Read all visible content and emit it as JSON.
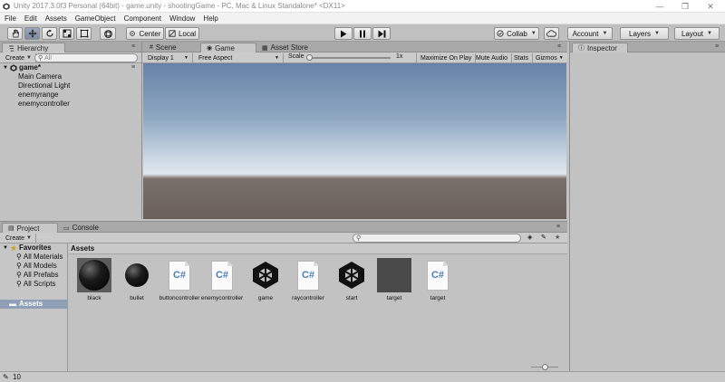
{
  "window": {
    "title": "Unity 2017.3.0f3 Personal (64bit) - game.unity - shootingGame - PC, Mac & Linux Standalone* <DX11>",
    "minimize": "—",
    "maximize": "❐",
    "close": "✕"
  },
  "menu": [
    "File",
    "Edit",
    "Assets",
    "GameObject",
    "Component",
    "Window",
    "Help"
  ],
  "toolbar": {
    "pivot_label": "Center",
    "space_label": "Local",
    "collab_label": "Collab",
    "account_label": "Account",
    "layers_label": "Layers",
    "layout_label": "Layout"
  },
  "hierarchy": {
    "tab_label": "Hierarchy",
    "create_label": "Create",
    "search_placeholder": "All",
    "scene_name": "game*",
    "items": [
      "Main Camera",
      "Directional Light",
      "enemyrange",
      "enemycontroller"
    ]
  },
  "center_tabs": {
    "scene": "Scene",
    "game": "Game",
    "asset_store": "Asset Store"
  },
  "game_bar": {
    "display": "Display 1",
    "aspect": "Free Aspect",
    "scale_label": "Scale",
    "scale_value": "1x",
    "maximize": "Maximize On Play",
    "mute": "Mute Audio",
    "stats": "Stats",
    "gizmos": "Gizmos"
  },
  "inspector": {
    "tab_label": "Inspector"
  },
  "project": {
    "tab_label": "Project",
    "console_label": "Console",
    "create_label": "Create",
    "favorites_label": "Favorites",
    "favorites": [
      "All Materials",
      "All Models",
      "All Prefabs",
      "All Scripts"
    ],
    "assets_root": "Assets",
    "breadcrumb": "Assets",
    "assets": [
      {
        "name": "black",
        "kind": "material-black"
      },
      {
        "name": "bullet",
        "kind": "material-black-small"
      },
      {
        "name": "buttoncontroller",
        "kind": "script"
      },
      {
        "name": "enemycontroller",
        "kind": "script"
      },
      {
        "name": "game",
        "kind": "unity-scene"
      },
      {
        "name": "raycontroller",
        "kind": "script"
      },
      {
        "name": "start",
        "kind": "unity-scene"
      },
      {
        "name": "target",
        "kind": "material-gray"
      },
      {
        "name": "target",
        "kind": "script"
      }
    ]
  },
  "status": {
    "count": "10"
  },
  "colors": {
    "sky_top": "#6a85a8",
    "sky_horizon": "#dfe8f0",
    "ground": "#6a5f5a",
    "selection": "#8e9fb6"
  }
}
